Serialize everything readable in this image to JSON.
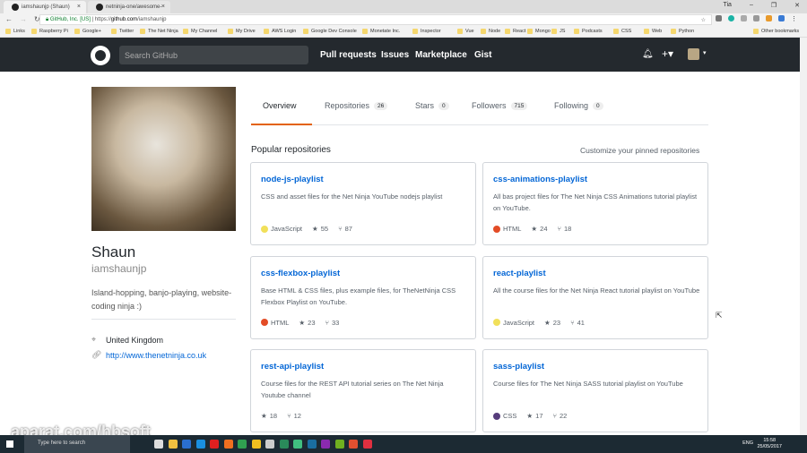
{
  "browser": {
    "tabs": [
      {
        "label": "iamshaunjp (Shaun)"
      },
      {
        "label": "netninja-one/awesome-"
      }
    ],
    "window_user": "Tia",
    "url_secure_label": "GitHub, Inc. [US]",
    "url_prefix": "https://",
    "url_domain": "github.com",
    "url_path": "/iamshaunjp",
    "bookmarks": [
      "Links",
      "Raspberry Pi",
      "Google+",
      "Twitter",
      "The Net Ninja",
      "My Channel",
      "My Drive",
      "AWS Login",
      "Google Dev Console",
      "Monetate Inc.",
      "Inspector",
      "Vue",
      "Node",
      "React",
      "Mongo",
      "JS",
      "Podcasts",
      "CSS",
      "Web",
      "Python"
    ],
    "other_bookmarks": "Other bookmarks"
  },
  "header": {
    "search_placeholder": "Search GitHub",
    "nav": [
      "Pull requests",
      "Issues",
      "Marketplace",
      "Gist"
    ]
  },
  "profile": {
    "name": "Shaun",
    "login": "iamshaunjp",
    "bio": "Island-hopping, banjo-playing, website-coding ninja :)",
    "location": "United Kingdom",
    "website": "http://www.thenetninja.co.uk"
  },
  "profile_tabs": [
    {
      "label": "Overview"
    },
    {
      "label": "Repositories",
      "count": "26"
    },
    {
      "label": "Stars",
      "count": "0"
    },
    {
      "label": "Followers",
      "count": "715"
    },
    {
      "label": "Following",
      "count": "0"
    }
  ],
  "popular": {
    "title": "Popular repositories",
    "customize": "Customize your pinned repositories",
    "repos": [
      {
        "name": "node-js-playlist",
        "desc": "CSS and asset files for the Net Ninja YouTube nodejs playlist",
        "lang": "JavaScript",
        "lang_color": "#f1e05a",
        "stars": "55",
        "forks": "87"
      },
      {
        "name": "css-animations-playlist",
        "desc": "All bas project files for The Net Ninja CSS Animations tutorial playlist on YouTube.",
        "lang": "HTML",
        "lang_color": "#e34c26",
        "stars": "24",
        "forks": "18"
      },
      {
        "name": "css-flexbox-playlist",
        "desc": "Base HTML & CSS files, plus example files, for TheNetNinja CSS Flexbox Playlist on YouTube.",
        "lang": "HTML",
        "lang_color": "#e34c26",
        "stars": "23",
        "forks": "33"
      },
      {
        "name": "react-playlist",
        "desc": "All the course files for the Net Ninja React tutorial playlist on YouTube",
        "lang": "JavaScript",
        "lang_color": "#f1e05a",
        "stars": "23",
        "forks": "41"
      },
      {
        "name": "rest-api-playlist",
        "desc": "Course files for the REST API tutorial series on The Net Ninja Youtube channel",
        "lang": null,
        "stars": "18",
        "forks": "12"
      },
      {
        "name": "sass-playlist",
        "desc": "Course files for The Net Ninja SASS tutorial playlist on YouTube",
        "lang": "CSS",
        "lang_color": "#563d7c",
        "stars": "17",
        "forks": "22"
      }
    ]
  },
  "taskbar": {
    "search_placeholder": "Type here to search",
    "lang": "ENG",
    "time": "15:58",
    "date": "25/05/2017"
  },
  "watermark": "aparat.com/hbsoft"
}
